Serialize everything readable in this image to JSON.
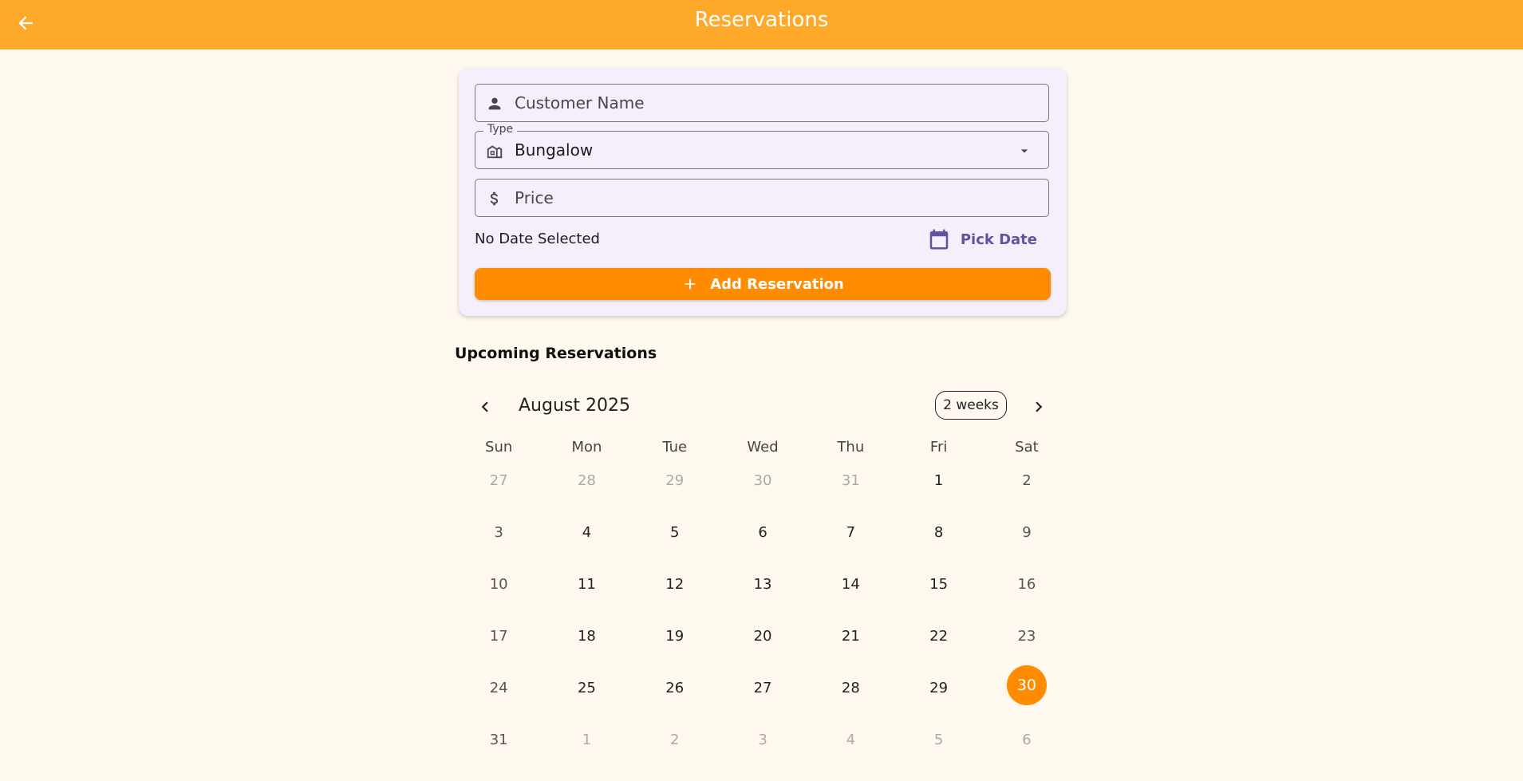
{
  "appbar": {
    "title": "Reservations",
    "back_icon": "arrow-left-icon",
    "color": "#ffa92b"
  },
  "form": {
    "customer_name": {
      "placeholder": "Customer Name",
      "value": "",
      "icon": "person-icon"
    },
    "type": {
      "label": "Type",
      "value": "Bungalow",
      "icon": "house-icon"
    },
    "price": {
      "placeholder": "Price",
      "value": "",
      "icon": "dollar-icon"
    },
    "date_status": "No Date Selected",
    "pick_date_label": "Pick Date",
    "add_button_label": "Add Reservation",
    "accent_color": "#ff8c00",
    "link_color": "#6750a4"
  },
  "upcoming": {
    "title": "Upcoming Reservations"
  },
  "calendar": {
    "month_label": "August 2025",
    "format_button": "2 weeks",
    "weekdays": [
      "Sun",
      "Mon",
      "Tue",
      "Wed",
      "Thu",
      "Fri",
      "Sat"
    ],
    "selected_day": "30",
    "weeks": [
      [
        {
          "d": "27",
          "o": true
        },
        {
          "d": "28",
          "o": true
        },
        {
          "d": "29",
          "o": true
        },
        {
          "d": "30",
          "o": true
        },
        {
          "d": "31",
          "o": true
        },
        {
          "d": "1"
        },
        {
          "d": "2"
        }
      ],
      [
        {
          "d": "3"
        },
        {
          "d": "4"
        },
        {
          "d": "5"
        },
        {
          "d": "6"
        },
        {
          "d": "7"
        },
        {
          "d": "8"
        },
        {
          "d": "9"
        }
      ],
      [
        {
          "d": "10"
        },
        {
          "d": "11"
        },
        {
          "d": "12"
        },
        {
          "d": "13"
        },
        {
          "d": "14"
        },
        {
          "d": "15"
        },
        {
          "d": "16"
        }
      ],
      [
        {
          "d": "17"
        },
        {
          "d": "18"
        },
        {
          "d": "19"
        },
        {
          "d": "20"
        },
        {
          "d": "21"
        },
        {
          "d": "22"
        },
        {
          "d": "23"
        }
      ],
      [
        {
          "d": "24"
        },
        {
          "d": "25"
        },
        {
          "d": "26"
        },
        {
          "d": "27"
        },
        {
          "d": "28"
        },
        {
          "d": "29"
        },
        {
          "d": "30",
          "s": true
        }
      ],
      [
        {
          "d": "31"
        },
        {
          "d": "1",
          "o": true
        },
        {
          "d": "2",
          "o": true
        },
        {
          "d": "3",
          "o": true
        },
        {
          "d": "4",
          "o": true
        },
        {
          "d": "5",
          "o": true
        },
        {
          "d": "6",
          "o": true
        }
      ]
    ]
  }
}
